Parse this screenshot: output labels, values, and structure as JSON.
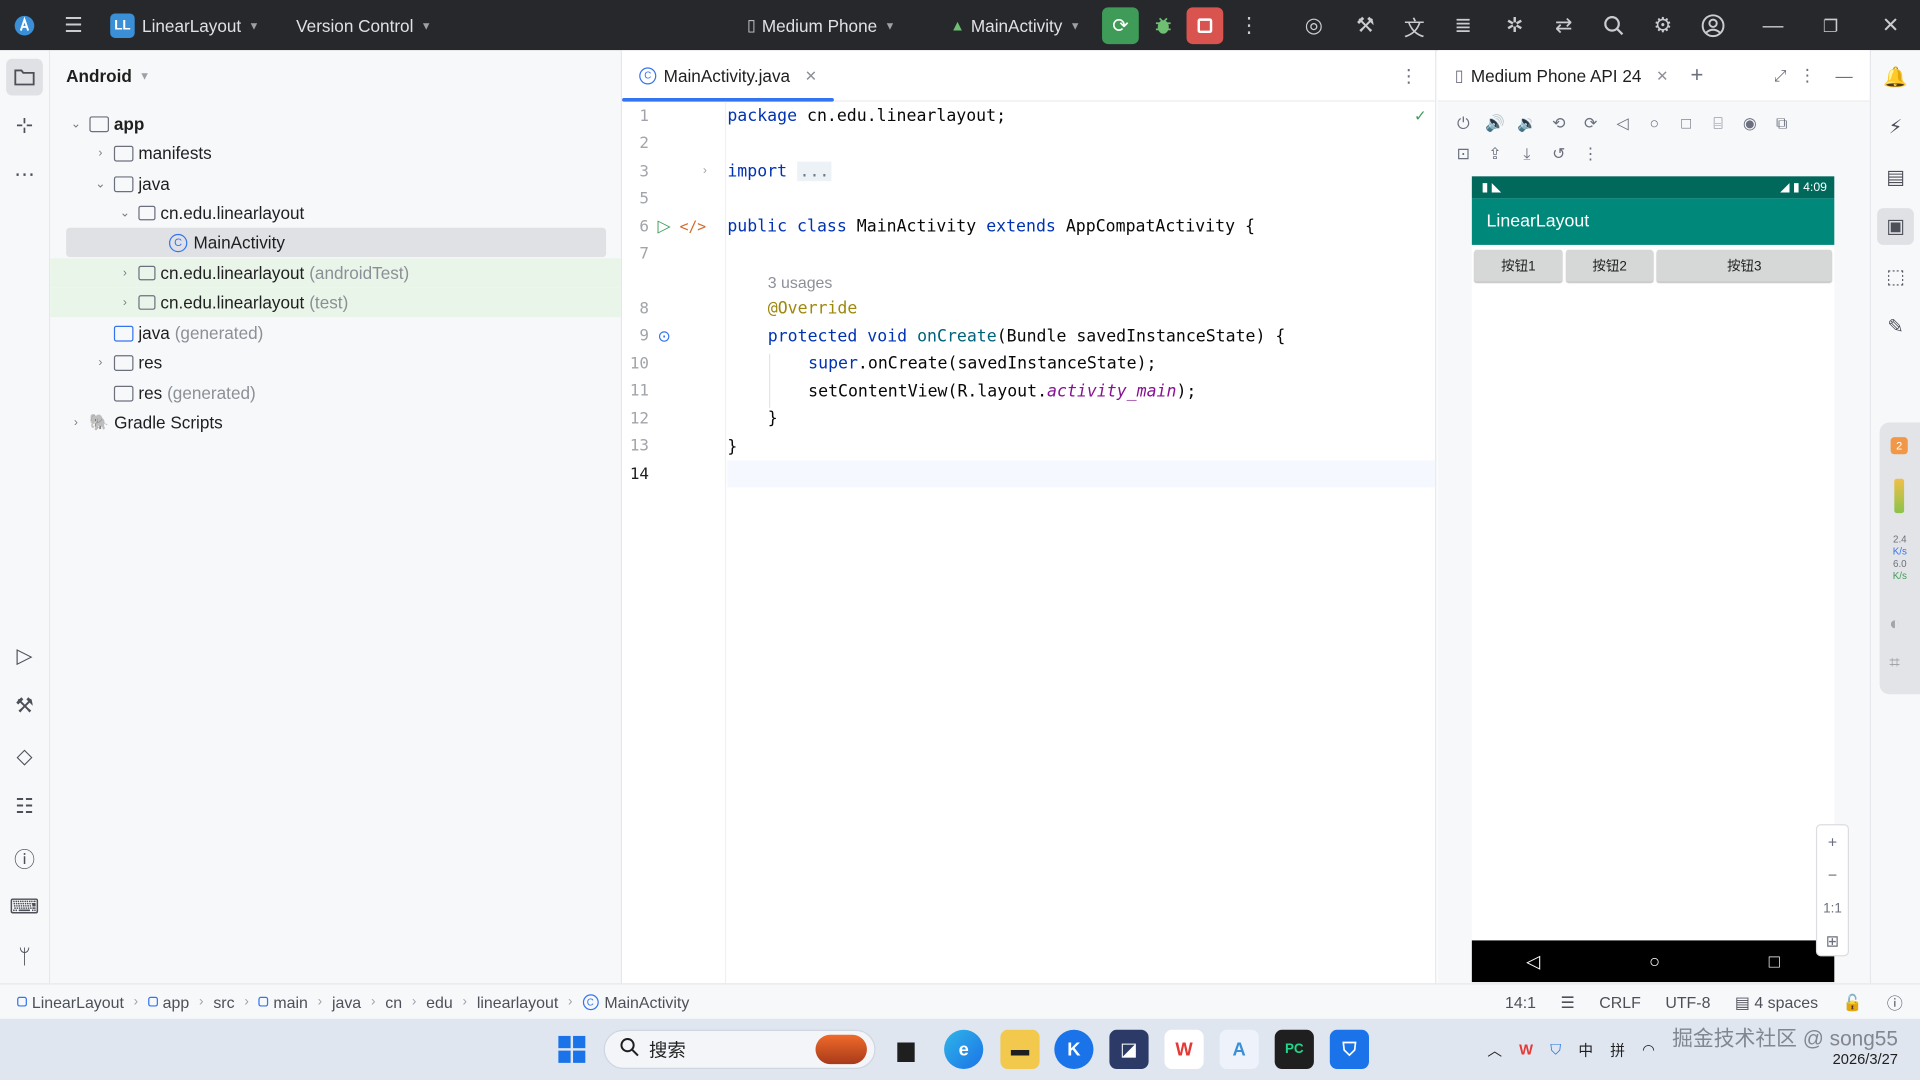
{
  "titlebar": {
    "project_badge": "LL",
    "project_name": "LinearLayout",
    "vcs": "Version Control",
    "device": "Medium Phone",
    "run_config": "MainActivity"
  },
  "project_panel": {
    "view_mode": "Android",
    "tree": [
      {
        "label": "app",
        "suffix": ""
      },
      {
        "label": "manifests",
        "suffix": ""
      },
      {
        "label": "java",
        "suffix": ""
      },
      {
        "label": "cn.edu.linearlayout",
        "suffix": ""
      },
      {
        "label": "MainActivity",
        "suffix": ""
      },
      {
        "label": "cn.edu.linearlayout",
        "suffix": "(androidTest)"
      },
      {
        "label": "cn.edu.linearlayout",
        "suffix": "(test)"
      },
      {
        "label": "java",
        "suffix": "(generated)"
      },
      {
        "label": "res",
        "suffix": ""
      },
      {
        "label": "res",
        "suffix": "(generated)"
      },
      {
        "label": "Gradle Scripts",
        "suffix": ""
      }
    ]
  },
  "editor": {
    "tab_name": "MainActivity.java",
    "line_numbers": [
      "1",
      "2",
      "3",
      "5",
      "6",
      "7",
      "8",
      "9",
      "10",
      "11",
      "12",
      "13",
      "14"
    ],
    "code": {
      "l1_kw": "package",
      "l1_rest": " cn.edu.linearlayout;",
      "l3_kw": "import",
      "l3_dots": "...",
      "l6_kw1": "public",
      "l6_kw2": "class",
      "l6_name": "MainActivity",
      "l6_kw3": "extends",
      "l6_rest": "AppCompatActivity {",
      "usages": "3 usages",
      "l8_ann": "@Override",
      "l9_kw1": "protected",
      "l9_kw2": "void",
      "l9_fn": "onCreate",
      "l9_rest": "(Bundle savedInstanceState) {",
      "l10_kw": "super",
      "l10_rest": ".onCreate(savedInstanceState);",
      "l11_a": "setContentView(R.layout.",
      "l11_it": "activity_main",
      "l11_b": ");",
      "l12": "}",
      "l13": "}"
    }
  },
  "emulator": {
    "tab_name": "Medium Phone API 24",
    "status_time": "4:09",
    "app_title": "LinearLayout",
    "buttons": [
      "按钮1",
      "按钮2",
      "按钮3"
    ],
    "zoom_reset": "1:1"
  },
  "right_widget": {
    "badge": "2",
    "up_speed": "2.4",
    "up_unit": "K/s",
    "down_speed": "6.0",
    "down_unit": "K/s"
  },
  "statusbar": {
    "breadcrumbs": [
      "LinearLayout",
      "app",
      "src",
      "main",
      "java",
      "cn",
      "edu",
      "linearlayout",
      "MainActivity"
    ],
    "position": "14:1",
    "line_sep": "CRLF",
    "encoding": "UTF-8",
    "indent": "4 spaces"
  },
  "taskbar": {
    "search_placeholder": "搜索",
    "ime_lang": "中",
    "ime_mode": "拼",
    "watermark": "掘金技术社区 @ song55",
    "date": "2026/3/27"
  },
  "colors": {
    "accent": "#3574f0",
    "app_primary": "#00897b",
    "app_primary_dark": "#00695c",
    "run_green": "#3f9c58",
    "stop_red": "#d9534f"
  }
}
